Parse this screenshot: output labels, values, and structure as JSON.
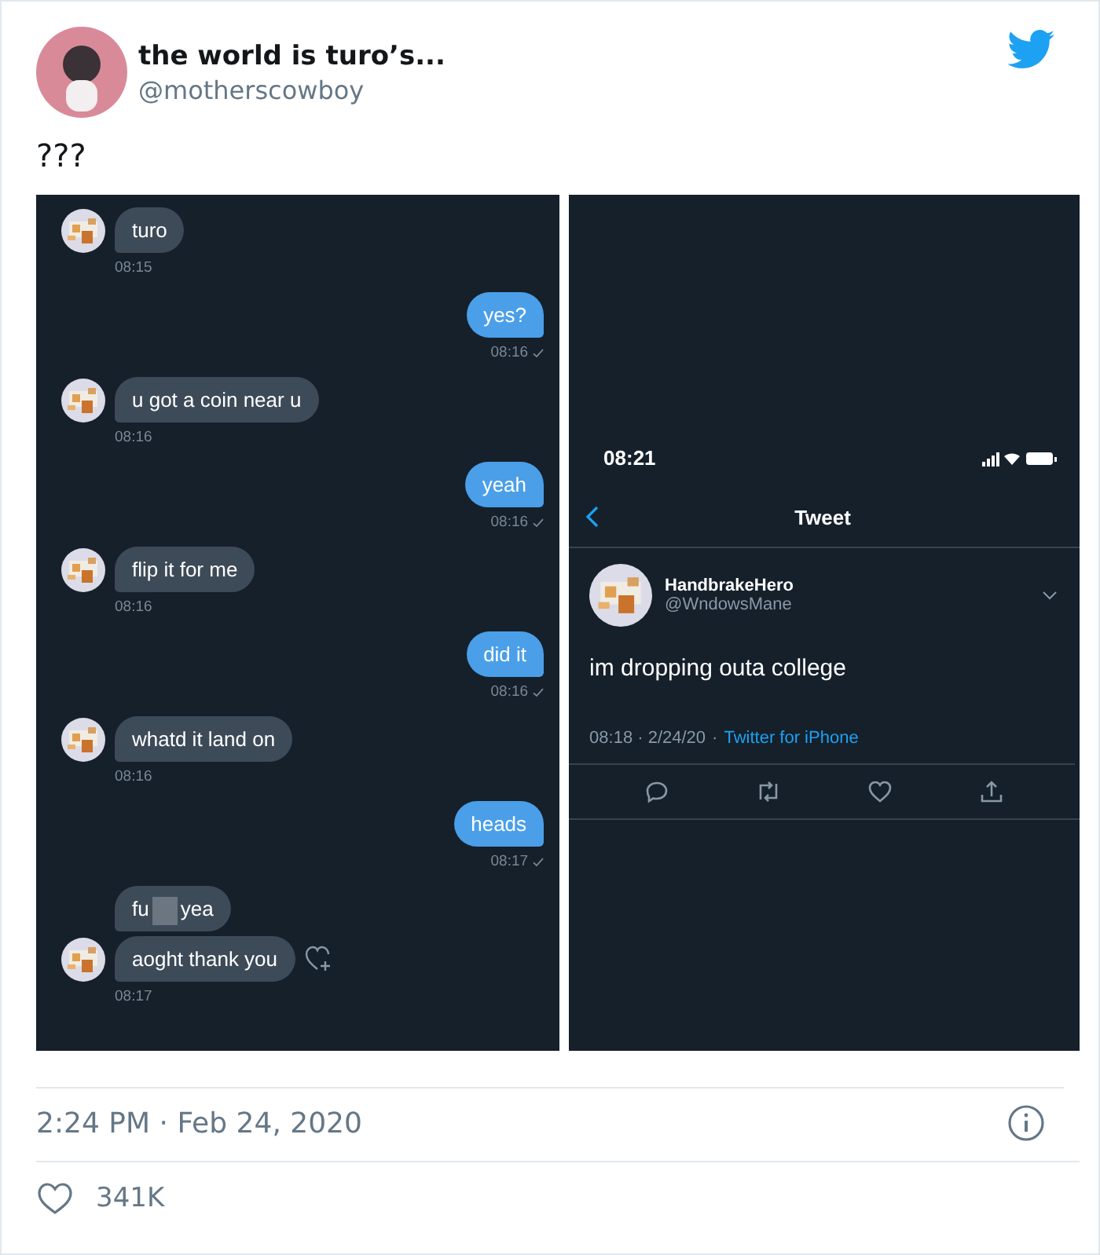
{
  "author": {
    "name": "the world is turo’s...",
    "handle": "@motherscowboy"
  },
  "text": "???",
  "chat": {
    "messages": [
      {
        "kind": "text",
        "outgoing": false,
        "text": "turo",
        "time": "08:15"
      },
      {
        "kind": "text",
        "outgoing": true,
        "text": "yes?",
        "time": "08:16",
        "delivered": true
      },
      {
        "kind": "text",
        "outgoing": false,
        "text": "u got a coin near u",
        "time": "08:16"
      },
      {
        "kind": "text",
        "outgoing": true,
        "text": "yeah",
        "time": "08:16",
        "delivered": true
      },
      {
        "kind": "text",
        "outgoing": false,
        "text": "flip it for me",
        "time": "08:16"
      },
      {
        "kind": "text",
        "outgoing": true,
        "text": "did it",
        "time": "08:16",
        "delivered": true
      },
      {
        "kind": "text",
        "outgoing": false,
        "text": "whatd it land on",
        "time": "08:16"
      },
      {
        "kind": "text",
        "outgoing": true,
        "text": "heads",
        "time": "08:17",
        "delivered": true
      },
      {
        "kind": "stack",
        "outgoing": false,
        "time": "08:17",
        "bubbles": [
          {
            "kind": "censored",
            "before": "fu",
            "after": "yea"
          },
          {
            "kind": "plain",
            "text": "aoght thank you"
          }
        ]
      }
    ]
  },
  "phone": {
    "status_time": "08:21",
    "nav_title": "Tweet",
    "tweet": {
      "name": "HandbrakeHero",
      "handle": "@WndowsMane",
      "text": "im dropping outa college",
      "timestamp": "08:18 · 2/24/20",
      "separator": "·",
      "source": "Twitter for iPhone"
    }
  },
  "footer": {
    "datetime": "2:24 PM · Feb 24, 2020",
    "likes": "341K"
  }
}
